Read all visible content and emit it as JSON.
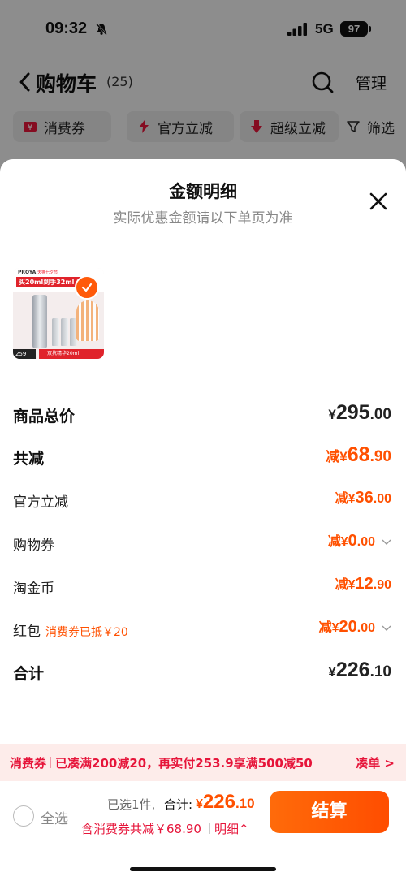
{
  "status_bar": {
    "time": "09:32",
    "network": "5G",
    "battery": "97"
  },
  "nav": {
    "title": "购物车",
    "count": "(25)",
    "manage_label": "管理"
  },
  "filters": [
    {
      "label": "消费券",
      "icon": "coupon-icon"
    },
    {
      "label": "官方立减",
      "icon": "lightning-icon"
    },
    {
      "label": "超级立减",
      "icon": "arrow-down-icon"
    },
    {
      "label": "筛选",
      "icon": "filter-icon"
    }
  ],
  "sheet": {
    "title": "金额明细",
    "subtitle": "实际优惠金额请以下单页为准"
  },
  "product": {
    "brand": "PROYA",
    "tag": "天猫七夕节",
    "banner": "买20ml到手32ml 两",
    "price_tag": "259",
    "bottom_label": "双抗精华20ml",
    "selected": true
  },
  "breakdown": [
    {
      "label": "商品总价",
      "prefix": "¥",
      "integer": "295",
      "decimal": ".00",
      "note": ""
    },
    {
      "label": "共减",
      "prefix": "减¥",
      "integer": "68",
      "decimal": ".90",
      "note": ""
    },
    {
      "label": "官方立减",
      "prefix": "减¥",
      "integer": "36",
      "decimal": ".00",
      "note": ""
    },
    {
      "label": "购物券",
      "prefix": "减¥",
      "integer": "0",
      "decimal": ".00",
      "note": ""
    },
    {
      "label": "淘金币",
      "prefix": "减¥",
      "integer": "12",
      "decimal": ".90",
      "note": ""
    },
    {
      "label": "红包",
      "prefix": "减¥",
      "integer": "20",
      "decimal": ".00",
      "note": "消费券已抵￥20"
    },
    {
      "label": "合计",
      "prefix": "¥",
      "integer": "226",
      "decimal": ".10",
      "note": ""
    }
  ],
  "promo": {
    "tag": "消费券",
    "text": "已凑满200减20，再实付253.9享满500减50",
    "link": "凑单 >"
  },
  "footer": {
    "select_all": "全选",
    "selected_count": "已选1件,",
    "total_label": "合计:",
    "total_prefix": "¥",
    "total_int": "226",
    "total_dec": ".10",
    "discount_text": "含消费券共减￥68.90",
    "detail_link": "明细⌃",
    "checkout": "结算"
  },
  "colors": {
    "accent": "#ff5000",
    "promo_red": "#e6153a"
  }
}
